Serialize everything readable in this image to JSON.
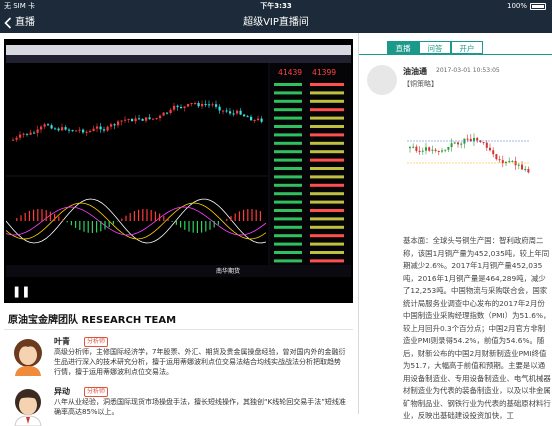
{
  "status_bar": {
    "carrier": "无 SIM 卡",
    "time": "下午3:33",
    "battery": "100%"
  },
  "nav": {
    "back_label": "直播",
    "title": "超级VIP直播间"
  },
  "video": {
    "play_icon": "pause-icon",
    "chart_prices": [
      "41439",
      "41399"
    ],
    "chart_caption": "南华期货"
  },
  "team": {
    "title": "原油宝金牌团队 RESEARCH TEAM",
    "members": [
      {
        "name": "叶青",
        "tag": "分析师",
        "desc": "高级分析师，主修国际经济学，7年股票、外汇、期货及贵金属操盘经验，曾对国内外的金融衍生品进行深入的技术研究分析，擅于运用蒂娜波利点位交易法结合均线实战战法分析把取趋势行情，擅于运用蒂娜波利点位交易法。"
      },
      {
        "name": "异动",
        "tag": "分析师",
        "desc": "八年从业经验，洞悉国际现货市场操盘手法，擅长短线操作，其独创“K线轮回交易手法”短线准确率高达85%以上。"
      }
    ]
  },
  "tabs": [
    {
      "label": "直播",
      "active": true
    },
    {
      "label": "问答",
      "active": false
    },
    {
      "label": "开户",
      "active": false
    }
  ],
  "post": {
    "user": "油油通",
    "time": "2017-03-01 10:53:05",
    "category": "【铜策略】",
    "text": "基本面：全球头号铜生产国：智利政府周二称，该国1月铜产量为452,035吨，较上年同期减少2.6%。2017年1月铜产量452,035吨，2016年1月铜产量是464,289吨，减少了12,253吨。中国物流与采购联合会，国家统计局服务业调查中心发布的2017年2月份中国制造业采购经理指数（PMI）为51.6%，较上月回升0.3个百分点；中国2月官方非制造业PMI则录得54.2%，前值为54.6%。随后，财新公布的中国2月财新制造业PMI终值为51.7，大幅高于前值和预期。主要是以通用设备制造业、专用设备制造业、电气机械器材制造业为代表的装备制造业，以及以非金属矿物制品业、钢铁行业为代表的基础原材料行业，反映出基础建设投资加快，工"
  }
}
